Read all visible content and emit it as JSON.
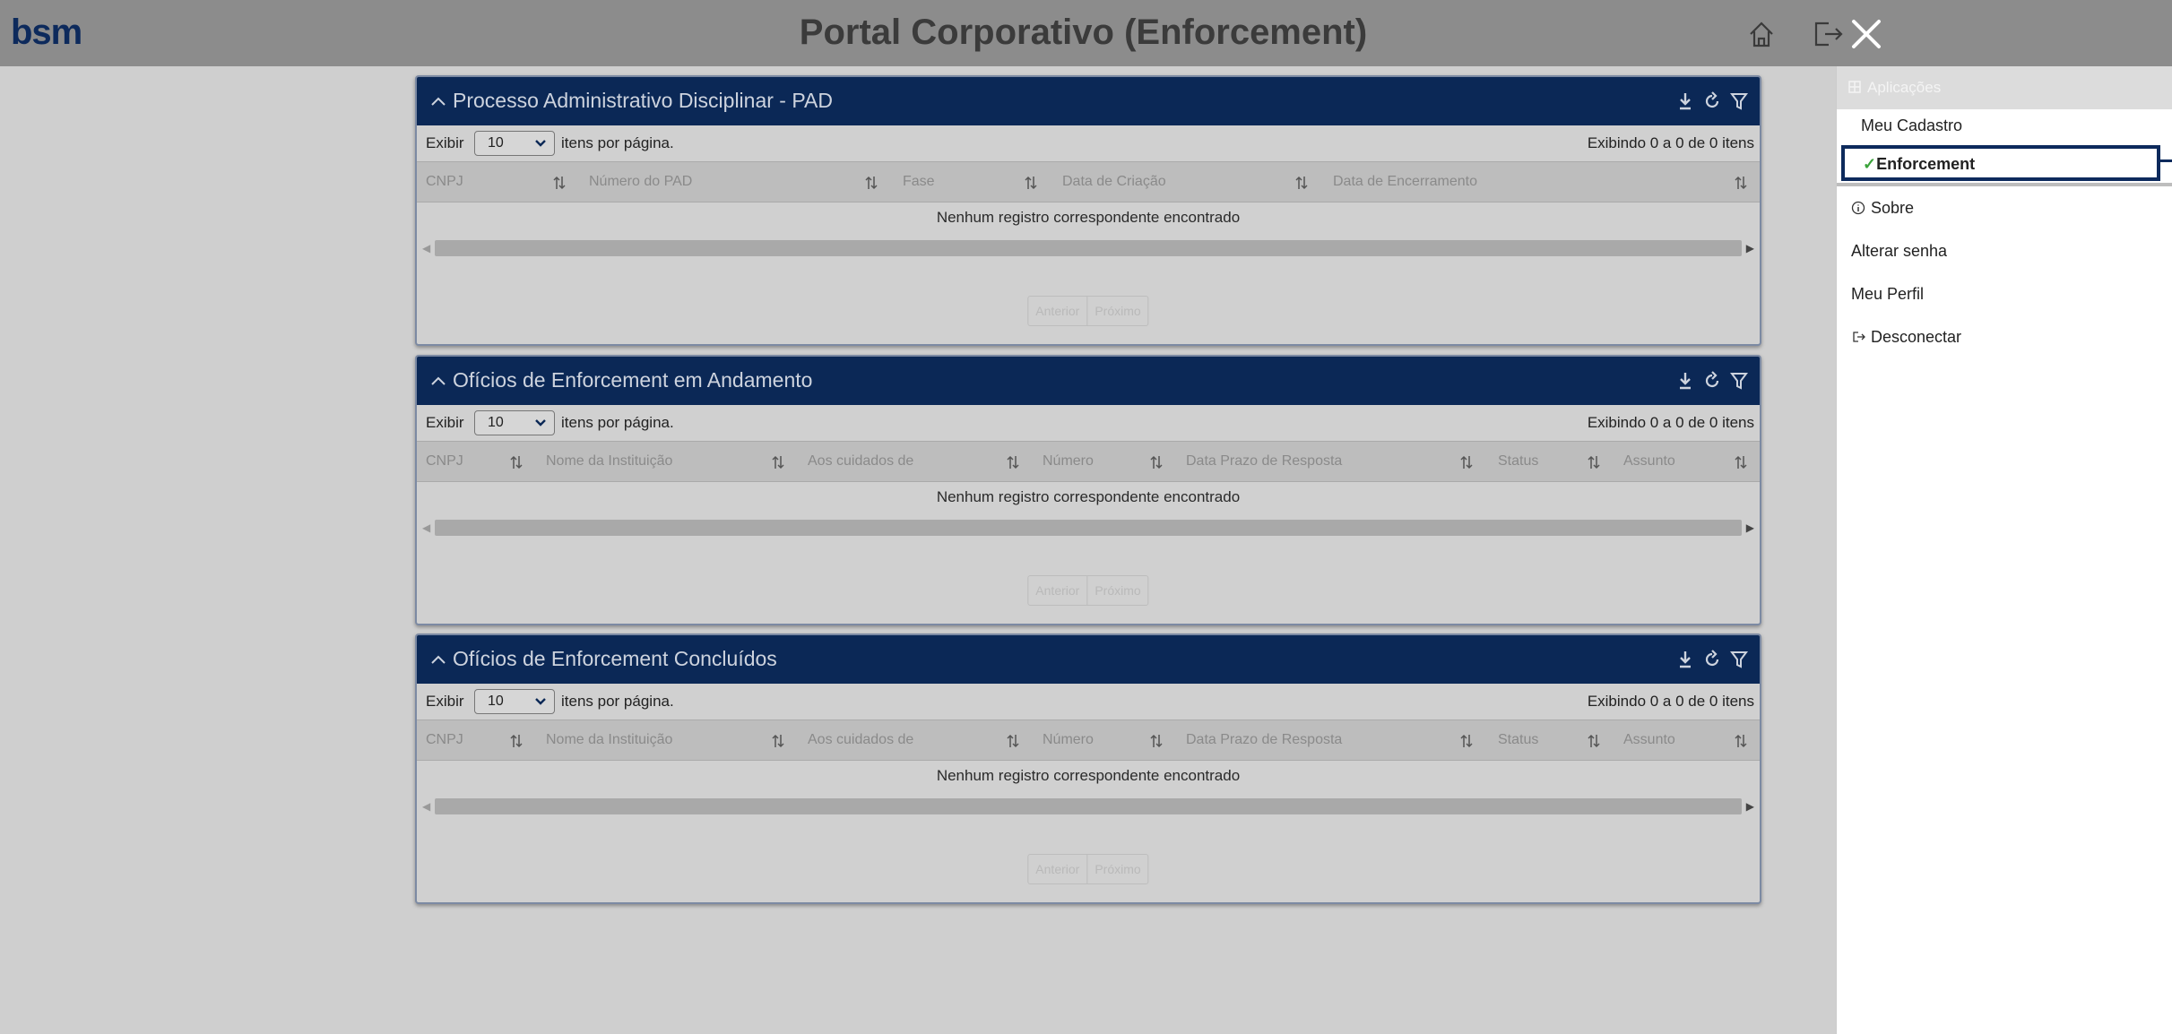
{
  "header": {
    "logo": "bsm",
    "title": "Portal Corporativo (Enforcement)",
    "icons": [
      "home-icon",
      "logout-icon",
      "close-icon"
    ]
  },
  "panels": [
    {
      "title": "Processo Administrativo Disciplinar - PAD",
      "exibir_label": "Exibir",
      "page_size": "10",
      "per_page_label": "itens por página.",
      "showing": "Exibindo 0 a 0 de 0 itens",
      "columns": [
        "CNPJ",
        "Número do PAD",
        "Fase",
        "Data de Criação",
        "Data de Encerramento"
      ],
      "empty_message": "Nenhum registro correspondente encontrado",
      "pager": {
        "previous": "Anterior",
        "next": "Próximo"
      }
    },
    {
      "title": "Ofícios de Enforcement em Andamento",
      "exibir_label": "Exibir",
      "page_size": "10",
      "per_page_label": "itens por página.",
      "showing": "Exibindo 0 a 0 de 0 itens",
      "columns": [
        "CNPJ",
        "Nome da Instituição",
        "Aos cuidados de",
        "Número",
        "Data Prazo de Resposta",
        "Status",
        "Assunto"
      ],
      "empty_message": "Nenhum registro correspondente encontrado",
      "pager": {
        "previous": "Anterior",
        "next": "Próximo"
      }
    },
    {
      "title": "Ofícios de Enforcement Concluídos",
      "exibir_label": "Exibir",
      "page_size": "10",
      "per_page_label": "itens por página.",
      "showing": "Exibindo 0 a 0 de 0 itens",
      "columns": [
        "CNPJ",
        "Nome da Instituição",
        "Aos cuidados de",
        "Número",
        "Data Prazo de Resposta",
        "Status",
        "Assunto"
      ],
      "empty_message": "Nenhum registro correspondente encontrado",
      "pager": {
        "previous": "Anterior",
        "next": "Próximo"
      }
    }
  ],
  "side_menu": {
    "section_title": "Aplicações",
    "apps": [
      "Meu Cadastro",
      "Enforcement"
    ],
    "active_app": "Enforcement",
    "items": [
      "Sobre",
      "Alterar senha",
      "Meu Perfil",
      "Desconectar"
    ]
  },
  "colors": {
    "panel_header": "#0b2856",
    "accent": "#0d2a5c",
    "check": "#3aa33a"
  }
}
